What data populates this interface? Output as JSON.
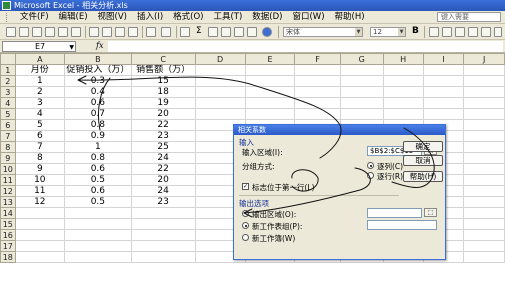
{
  "window": {
    "title": "Microsoft Excel - 相关分析.xls"
  },
  "menubar": {
    "items": [
      "文件(F)",
      "编辑(E)",
      "视图(V)",
      "插入(I)",
      "格式(O)",
      "工具(T)",
      "数据(D)",
      "窗口(W)",
      "帮助(H)"
    ],
    "help_placeholder": "键入需要"
  },
  "toolbar": {
    "font_name": "宋体",
    "font_size": "12",
    "sigma": "Σ",
    "bold": "B"
  },
  "formula_bar": {
    "cell_ref": "E7",
    "fx": "fx",
    "value": ""
  },
  "sheet": {
    "columns": [
      "A",
      "B",
      "C",
      "D",
      "E",
      "F",
      "G",
      "H",
      "I",
      "J"
    ],
    "row_numbers": [
      "1",
      "2",
      "3",
      "4",
      "5",
      "6",
      "7",
      "8",
      "9",
      "10",
      "11",
      "12",
      "13",
      "14",
      "15",
      "16",
      "17",
      "18"
    ],
    "headers": [
      "月份",
      "促销投入（万）",
      "销售额（万）"
    ],
    "rows": [
      [
        "1",
        "0.3",
        "15"
      ],
      [
        "2",
        "0.4",
        "18"
      ],
      [
        "3",
        "0.6",
        "19"
      ],
      [
        "4",
        "0.7",
        "20"
      ],
      [
        "5",
        "0.8",
        "22"
      ],
      [
        "6",
        "0.9",
        "23"
      ],
      [
        "7",
        "1",
        "25"
      ],
      [
        "8",
        "0.8",
        "24"
      ],
      [
        "9",
        "0.6",
        "22"
      ],
      [
        "10",
        "0.5",
        "20"
      ],
      [
        "11",
        "0.6",
        "24"
      ],
      [
        "12",
        "0.5",
        "23"
      ]
    ]
  },
  "dialog": {
    "title": "相关系数",
    "input_section": "输入",
    "input_range_label": "输入区域(I):",
    "input_range_value": "$B$2:$C$13",
    "group_by_label": "分组方式:",
    "by_columns": "逐列(C)",
    "by_rows": "逐行(R)",
    "labels_first_row": "标志位于第一行(L)",
    "output_section": "输出选项",
    "output_range": "输出区域(O):",
    "new_worksheet": "新工作表组(P):",
    "new_workbook": "新工作簿(W)",
    "ok": "确定",
    "cancel": "取消",
    "help": "帮助(H)"
  },
  "colors": {
    "title_bar": "#2a56b8",
    "chrome": "#ece9d8",
    "annotation_ink": "#111111"
  }
}
